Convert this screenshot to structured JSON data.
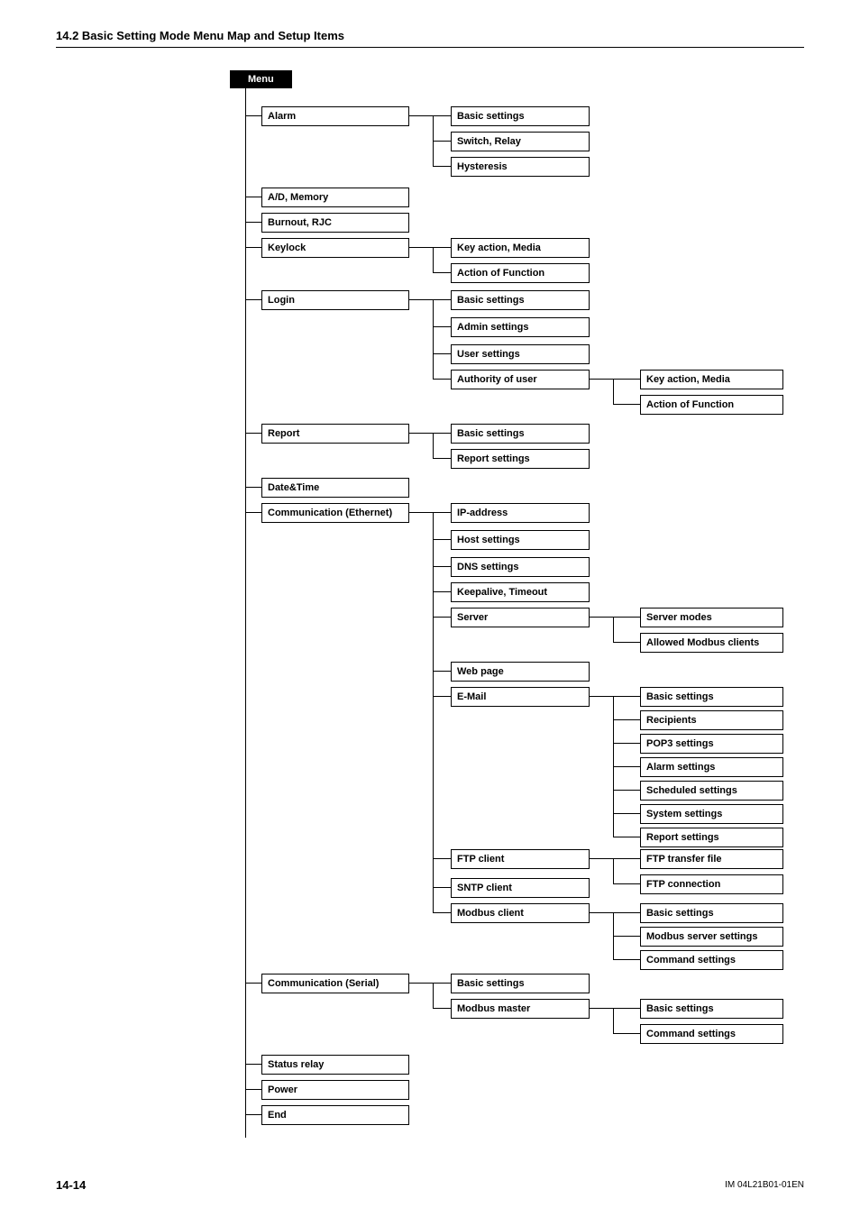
{
  "heading": "14.2  Basic Setting Mode Menu Map and Setup Items",
  "menu_tab": "Menu",
  "footer_left": "14-14",
  "footer_right": "IM 04L21B01-01EN",
  "items": {
    "alarm": "Alarm",
    "alarm_basic": "Basic settings",
    "alarm_switch": "Switch, Relay",
    "alarm_hyst": "Hysteresis",
    "ad_memory": "A/D, Memory",
    "burnout": "Burnout, RJC",
    "keylock": "Keylock",
    "keylock_key": "Key action, Media",
    "keylock_action": "Action of Function",
    "login": "Login",
    "login_basic": "Basic settings",
    "login_admin": "Admin settings",
    "login_user": "User settings",
    "login_auth": "Authority of user",
    "auth_key": "Key action, Media",
    "auth_action": "Action of Function",
    "report": "Report",
    "report_basic": "Basic settings",
    "report_settings": "Report settings",
    "datetime": "Date&Time",
    "comm_eth": "Communication (Ethernet)",
    "eth_ip": "IP-address",
    "eth_host": "Host settings",
    "eth_dns": "DNS settings",
    "eth_keep": "Keepalive, Timeout",
    "eth_server": "Server",
    "srv_modes": "Server modes",
    "srv_allowed": "Allowed Modbus clients",
    "eth_web": "Web page",
    "eth_email": "E-Mail",
    "em_basic": "Basic settings",
    "em_recip": "Recipients",
    "em_pop3": "POP3 settings",
    "em_alarm": "Alarm settings",
    "em_sched": "Scheduled settings",
    "em_sys": "System settings",
    "em_report": "Report settings",
    "eth_ftp": "FTP client",
    "ftp_transfer": "FTP transfer file",
    "ftp_conn": "FTP connection",
    "eth_sntp": "SNTP client",
    "eth_modbus": "Modbus client",
    "mb_basic": "Basic settings",
    "mb_server": "Modbus server settings",
    "mb_cmd": "Command settings",
    "comm_serial": "Communication (Serial)",
    "ser_basic": "Basic settings",
    "ser_master": "Modbus master",
    "mm_basic": "Basic settings",
    "mm_cmd": "Command settings",
    "status_relay": "Status relay",
    "power": "Power",
    "end": "End"
  }
}
